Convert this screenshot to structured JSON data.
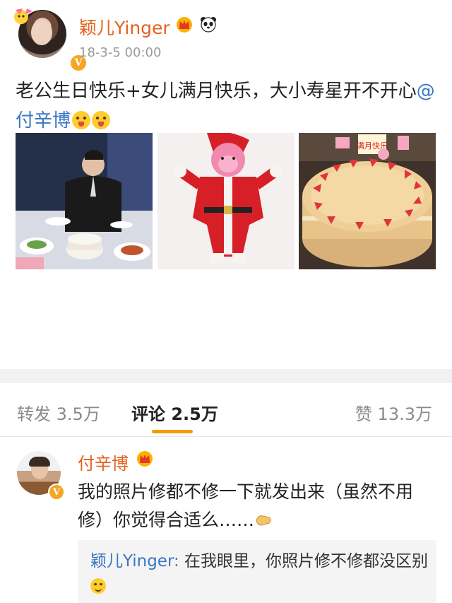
{
  "post": {
    "author": "颖儿Yinger",
    "timestamp": "18-3-5 00:00",
    "text_main": "老公生日快乐+女儿满月快乐，大小寿星开不开心",
    "mention": "@付辛博",
    "badge_icons": [
      "crown-icon",
      "panda-icon"
    ],
    "verified_mark": "V",
    "photos": [
      {
        "icon": "birthday-dinner-photo"
      },
      {
        "icon": "baby-in-santa-suit-photo"
      },
      {
        "icon": "strawberry-cake-photo"
      }
    ]
  },
  "tabs": {
    "repost": "转发 3.5万",
    "comment": "评论 2.5万",
    "like": "赞 13.3万",
    "active": "comment"
  },
  "comment": {
    "author": "付辛博",
    "verified_mark": "V",
    "text": "我的照片修都不修一下就发出来（虽然不用修）你觉得合适么……",
    "reply": {
      "author": "颖儿Yinger:",
      "text": " 在我眼里，你照片修不修都没区别"
    }
  },
  "colors": {
    "author_orange": "#e8601c",
    "link_blue": "#3a76c4",
    "tab_underline": "#f79a00",
    "verified_gold": "#f5a623"
  }
}
